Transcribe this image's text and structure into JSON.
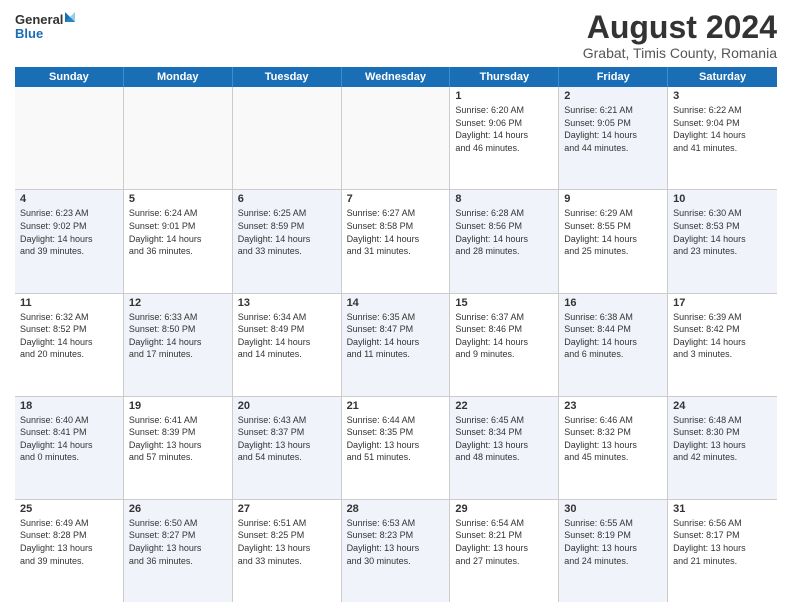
{
  "logo": {
    "general": "General",
    "blue": "Blue"
  },
  "title": "August 2024",
  "subtitle": "Grabat, Timis County, Romania",
  "days": [
    "Sunday",
    "Monday",
    "Tuesday",
    "Wednesday",
    "Thursday",
    "Friday",
    "Saturday"
  ],
  "rows": [
    [
      {
        "day": "",
        "info": "",
        "empty": true
      },
      {
        "day": "",
        "info": "",
        "empty": true
      },
      {
        "day": "",
        "info": "",
        "empty": true
      },
      {
        "day": "",
        "info": "",
        "empty": true
      },
      {
        "day": "1",
        "info": "Sunrise: 6:20 AM\nSunset: 9:06 PM\nDaylight: 14 hours\nand 46 minutes."
      },
      {
        "day": "2",
        "info": "Sunrise: 6:21 AM\nSunset: 9:05 PM\nDaylight: 14 hours\nand 44 minutes.",
        "alt": true
      },
      {
        "day": "3",
        "info": "Sunrise: 6:22 AM\nSunset: 9:04 PM\nDaylight: 14 hours\nand 41 minutes."
      }
    ],
    [
      {
        "day": "4",
        "info": "Sunrise: 6:23 AM\nSunset: 9:02 PM\nDaylight: 14 hours\nand 39 minutes.",
        "alt": true
      },
      {
        "day": "5",
        "info": "Sunrise: 6:24 AM\nSunset: 9:01 PM\nDaylight: 14 hours\nand 36 minutes."
      },
      {
        "day": "6",
        "info": "Sunrise: 6:25 AM\nSunset: 8:59 PM\nDaylight: 14 hours\nand 33 minutes.",
        "alt": true
      },
      {
        "day": "7",
        "info": "Sunrise: 6:27 AM\nSunset: 8:58 PM\nDaylight: 14 hours\nand 31 minutes."
      },
      {
        "day": "8",
        "info": "Sunrise: 6:28 AM\nSunset: 8:56 PM\nDaylight: 14 hours\nand 28 minutes.",
        "alt": true
      },
      {
        "day": "9",
        "info": "Sunrise: 6:29 AM\nSunset: 8:55 PM\nDaylight: 14 hours\nand 25 minutes."
      },
      {
        "day": "10",
        "info": "Sunrise: 6:30 AM\nSunset: 8:53 PM\nDaylight: 14 hours\nand 23 minutes.",
        "alt": true
      }
    ],
    [
      {
        "day": "11",
        "info": "Sunrise: 6:32 AM\nSunset: 8:52 PM\nDaylight: 14 hours\nand 20 minutes."
      },
      {
        "day": "12",
        "info": "Sunrise: 6:33 AM\nSunset: 8:50 PM\nDaylight: 14 hours\nand 17 minutes.",
        "alt": true
      },
      {
        "day": "13",
        "info": "Sunrise: 6:34 AM\nSunset: 8:49 PM\nDaylight: 14 hours\nand 14 minutes."
      },
      {
        "day": "14",
        "info": "Sunrise: 6:35 AM\nSunset: 8:47 PM\nDaylight: 14 hours\nand 11 minutes.",
        "alt": true
      },
      {
        "day": "15",
        "info": "Sunrise: 6:37 AM\nSunset: 8:46 PM\nDaylight: 14 hours\nand 9 minutes."
      },
      {
        "day": "16",
        "info": "Sunrise: 6:38 AM\nSunset: 8:44 PM\nDaylight: 14 hours\nand 6 minutes.",
        "alt": true
      },
      {
        "day": "17",
        "info": "Sunrise: 6:39 AM\nSunset: 8:42 PM\nDaylight: 14 hours\nand 3 minutes."
      }
    ],
    [
      {
        "day": "18",
        "info": "Sunrise: 6:40 AM\nSunset: 8:41 PM\nDaylight: 14 hours\nand 0 minutes.",
        "alt": true
      },
      {
        "day": "19",
        "info": "Sunrise: 6:41 AM\nSunset: 8:39 PM\nDaylight: 13 hours\nand 57 minutes."
      },
      {
        "day": "20",
        "info": "Sunrise: 6:43 AM\nSunset: 8:37 PM\nDaylight: 13 hours\nand 54 minutes.",
        "alt": true
      },
      {
        "day": "21",
        "info": "Sunrise: 6:44 AM\nSunset: 8:35 PM\nDaylight: 13 hours\nand 51 minutes."
      },
      {
        "day": "22",
        "info": "Sunrise: 6:45 AM\nSunset: 8:34 PM\nDaylight: 13 hours\nand 48 minutes.",
        "alt": true
      },
      {
        "day": "23",
        "info": "Sunrise: 6:46 AM\nSunset: 8:32 PM\nDaylight: 13 hours\nand 45 minutes."
      },
      {
        "day": "24",
        "info": "Sunrise: 6:48 AM\nSunset: 8:30 PM\nDaylight: 13 hours\nand 42 minutes.",
        "alt": true
      }
    ],
    [
      {
        "day": "25",
        "info": "Sunrise: 6:49 AM\nSunset: 8:28 PM\nDaylight: 13 hours\nand 39 minutes."
      },
      {
        "day": "26",
        "info": "Sunrise: 6:50 AM\nSunset: 8:27 PM\nDaylight: 13 hours\nand 36 minutes.",
        "alt": true
      },
      {
        "day": "27",
        "info": "Sunrise: 6:51 AM\nSunset: 8:25 PM\nDaylight: 13 hours\nand 33 minutes."
      },
      {
        "day": "28",
        "info": "Sunrise: 6:53 AM\nSunset: 8:23 PM\nDaylight: 13 hours\nand 30 minutes.",
        "alt": true
      },
      {
        "day": "29",
        "info": "Sunrise: 6:54 AM\nSunset: 8:21 PM\nDaylight: 13 hours\nand 27 minutes."
      },
      {
        "day": "30",
        "info": "Sunrise: 6:55 AM\nSunset: 8:19 PM\nDaylight: 13 hours\nand 24 minutes.",
        "alt": true
      },
      {
        "day": "31",
        "info": "Sunrise: 6:56 AM\nSunset: 8:17 PM\nDaylight: 13 hours\nand 21 minutes."
      }
    ]
  ]
}
